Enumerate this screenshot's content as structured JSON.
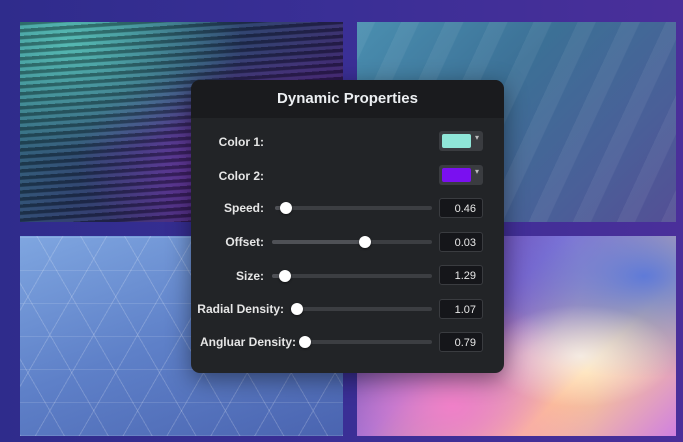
{
  "panel": {
    "title": "Dynamic Properties",
    "color1": {
      "label": "Color 1:",
      "value": "#8fe6d8"
    },
    "color2": {
      "label": "Color 2:",
      "value": "#7a10f0"
    },
    "sliders": [
      {
        "label": "Speed:",
        "value": "0.46",
        "level": 0.07
      },
      {
        "label": "Offset:",
        "value": "0.03",
        "level": 0.58
      },
      {
        "label": "Size:",
        "value": "1.29",
        "level": 0.08
      },
      {
        "label": "Radial Density:",
        "value": "1.07",
        "level": 0.0
      },
      {
        "label": "Angluar Density:",
        "value": "0.79",
        "level": 0.0
      }
    ]
  }
}
